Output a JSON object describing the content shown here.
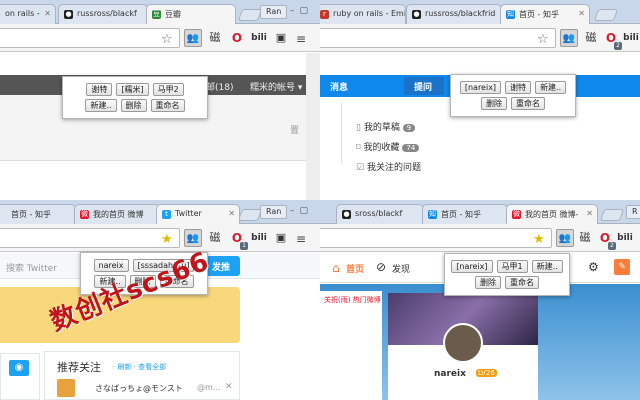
{
  "q1": {
    "tabs": [
      {
        "label": "on rails - ",
        "favicon": "rails-icon",
        "color": "#c0392b"
      },
      {
        "label": "russross/blackf",
        "favicon": "github-icon",
        "color": "#222222"
      },
      {
        "label": "豆瓣",
        "favicon": "douban-icon",
        "color": "#2e8b3a"
      }
    ],
    "user": "Ran",
    "popup": {
      "row1": [
        "谢特",
        "[糯米]",
        "马甲2"
      ],
      "row2": [
        "新建..",
        "删除",
        "重命名"
      ]
    },
    "page": {
      "nav_count": "邮(18)",
      "account": "糯米的帐号 ▾",
      "side_text": "置"
    }
  },
  "q2": {
    "tabs": [
      {
        "label": "ruby on rails - Emi",
        "favicon": "rails-icon",
        "color": "#c0392b"
      },
      {
        "label": "russross/blackfrid",
        "favicon": "github-icon",
        "color": "#222222"
      },
      {
        "label": "首页 - 知乎",
        "favicon": "zhihu-icon",
        "color": "#0f88eb"
      }
    ],
    "user": "Ran",
    "opera_badge": "2",
    "popup": {
      "row1": [
        "[nareix]",
        "谢特",
        "新建.."
      ],
      "row2": [
        "删除",
        "重命名"
      ]
    },
    "page": {
      "nav_item": "消息",
      "ask_button": "提问",
      "drafts": {
        "label": "我的草稿",
        "count": "9"
      },
      "favorites": {
        "label": "我的收藏",
        "count": "74"
      },
      "following": {
        "label": "我关注的问题"
      }
    }
  },
  "q3": {
    "tabs": [
      {
        "label": "首页 - 知乎",
        "favicon": "zhihu-icon",
        "color": "#0f88eb"
      },
      {
        "label": "我的首页 微博",
        "favicon": "weibo-icon",
        "color": "#e6162d"
      },
      {
        "label": "Twitter",
        "favicon": "twitter-icon",
        "color": "#1da1f2"
      }
    ],
    "user": "Ran",
    "opera_badge": "1",
    "popup": {
      "row1": [
        "nareix",
        "[sssadaharu]"
      ],
      "row2": [
        "新建..",
        "删除",
        "重命名"
      ]
    },
    "page": {
      "search_placeholder": "搜索 Twitter",
      "tweet_button": "发推",
      "recommend_title": "推荐关注",
      "recommend_links": "· 刷新 · 查看全部",
      "suggested_user": "さなばっちょ@モンスト",
      "suggested_handle": "@m...",
      "watermark": "数创社scs66"
    }
  },
  "q4": {
    "tabs": [
      {
        "label": "sross/blackf",
        "favicon": "github-icon",
        "color": "#222222"
      },
      {
        "label": "首页 - 知乎",
        "favicon": "zhihu-icon",
        "color": "#0f88eb"
      },
      {
        "label": "我的首页 微博-",
        "favicon": "weibo-icon",
        "color": "#e6162d"
      }
    ],
    "user": "R",
    "opera_badge": "2",
    "popup": {
      "row1": [
        "[nareix]",
        "马甲1",
        "新建.."
      ],
      "row2": [
        "删除",
        "重命名"
      ]
    },
    "page": {
      "nav_home": "首页",
      "nav_discover": "发现",
      "side_links": "关祝(雨)  热门微博",
      "username": "nareix",
      "level": "LV26"
    }
  }
}
